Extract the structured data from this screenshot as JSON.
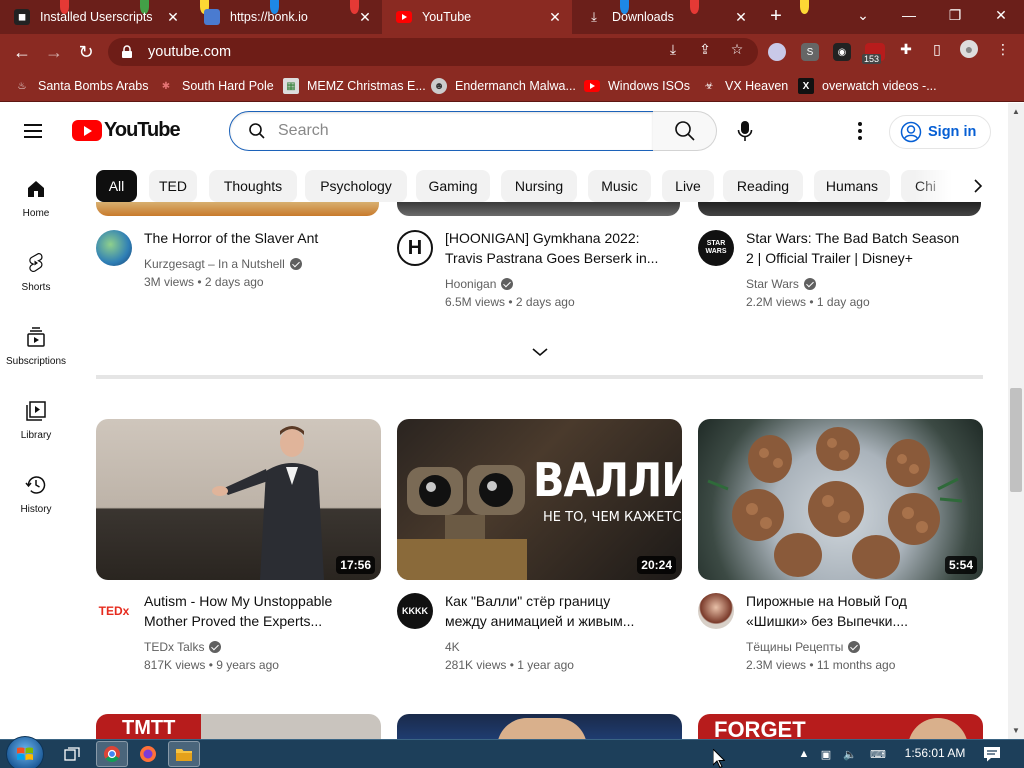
{
  "browser": {
    "tabs": [
      {
        "title": "Installed Userscripts",
        "active": false
      },
      {
        "title": "https://bonk.io",
        "active": false
      },
      {
        "title": "YouTube",
        "active": true
      },
      {
        "title": "Downloads",
        "active": false
      }
    ],
    "url": "youtube.com",
    "extension_badge": "153",
    "bookmarks": [
      {
        "label": "Santa Bombs Arabs"
      },
      {
        "label": "South Hard Pole"
      },
      {
        "label": "MEMZ Christmas E..."
      },
      {
        "label": "Endermanch Malwa..."
      },
      {
        "label": "Windows ISOs"
      },
      {
        "label": "VX Heaven"
      },
      {
        "label": "overwatch videos -..."
      }
    ],
    "frame_color": "#8a2a22"
  },
  "youtube": {
    "logo_text": "YouTube",
    "search_placeholder": "Search",
    "sign_in": "Sign in",
    "accent": "#ff0000",
    "link_color": "#065fd4",
    "guide": [
      {
        "label": "Home",
        "icon": "home-icon"
      },
      {
        "label": "Shorts",
        "icon": "shorts-icon"
      },
      {
        "label": "Subscriptions",
        "icon": "subscriptions-icon"
      },
      {
        "label": "Library",
        "icon": "library-icon"
      },
      {
        "label": "History",
        "icon": "history-icon"
      }
    ],
    "chips": [
      "All",
      "TED",
      "Thoughts",
      "Psychology",
      "Gaming",
      "Nursing",
      "Music",
      "Live",
      "Reading",
      "Humans",
      "Chi"
    ],
    "top_row": [
      {
        "title_line1": "The Horror of the Slaver Ant",
        "title_line2": "",
        "channel": "Kurzgesagt – In a Nutshell",
        "verified": true,
        "views": "3M views",
        "age": "2 days ago"
      },
      {
        "title_line1": "[HOONIGAN] Gymkhana 2022:",
        "title_line2": "Travis Pastrana Goes Berserk in...",
        "channel": "Hoonigan",
        "verified": true,
        "views": "6.5M views",
        "age": "2 days ago",
        "avatar_text": "H"
      },
      {
        "title_line1": "Star Wars: The Bad Batch Season",
        "title_line2": "2 | Official Trailer | Disney+",
        "channel": "Star Wars",
        "verified": true,
        "views": "2.2M views",
        "age": "1 day ago",
        "avatar_text": "STAR WARS"
      }
    ],
    "bottom_row": [
      {
        "title_line1": "Autism - How My Unstoppable",
        "title_line2": "Mother Proved the Experts...",
        "channel": "TEDx Talks",
        "verified": true,
        "views": "817K views",
        "age": "9 years ago",
        "duration": "17:56",
        "avatar_text": "TEDx"
      },
      {
        "title_line1": "Как \"Валли\" стёр границу",
        "title_line2": "между анимацией и живым...",
        "channel": "4K",
        "verified": false,
        "views": "281K views",
        "age": "1 year ago",
        "duration": "20:24",
        "avatar_text": "KKKK",
        "thumb_text_big": "ВАЛЛИ",
        "thumb_text_small": "НЕ ТО, ЧЕМ КАЖЕТСЯ"
      },
      {
        "title_line1": "Пирожные на Новый Год",
        "title_line2": "«Шишки» без Выпечки....",
        "channel": "Тёщины Рецепты",
        "verified": true,
        "views": "2.3M views",
        "age": "11 months ago",
        "duration": "5:54"
      }
    ],
    "next_row_thumb_text": [
      "TMTT",
      "FORGET"
    ]
  },
  "taskbar": {
    "clock": "1:56:01 AM"
  }
}
